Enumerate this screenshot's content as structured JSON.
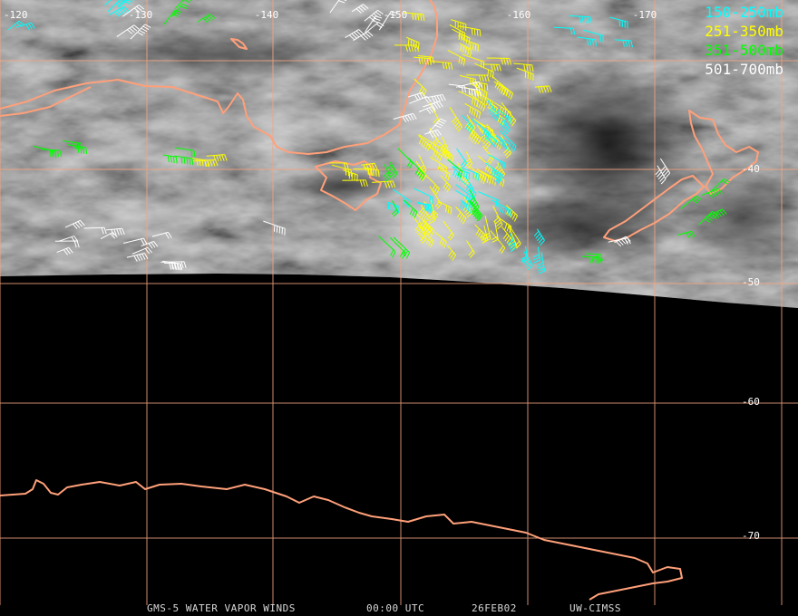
{
  "map": {
    "longitude_labels": [
      "-120",
      "-130",
      "-140",
      "-150",
      "-160",
      "-170"
    ],
    "latitude_labels": [
      "-40",
      "-50",
      "-60",
      "-70"
    ],
    "colors": {
      "graticule": "#f4a582",
      "coastline": "#ffa07a",
      "no_data": "#000000"
    }
  },
  "legend": {
    "items": [
      {
        "label": "150-250mb",
        "color": "#00ffff"
      },
      {
        "label": "251-350mb",
        "color": "#ffff00"
      },
      {
        "label": "351-500mb",
        "color": "#00ff00"
      },
      {
        "label": "501-700mb",
        "color": "#ffffff"
      }
    ]
  },
  "footer": {
    "product": "GMS-5 WATER VAPOR WINDS",
    "time": "00:00 UTC",
    "date": "26FEB02",
    "source": "UW-CIMSS"
  }
}
